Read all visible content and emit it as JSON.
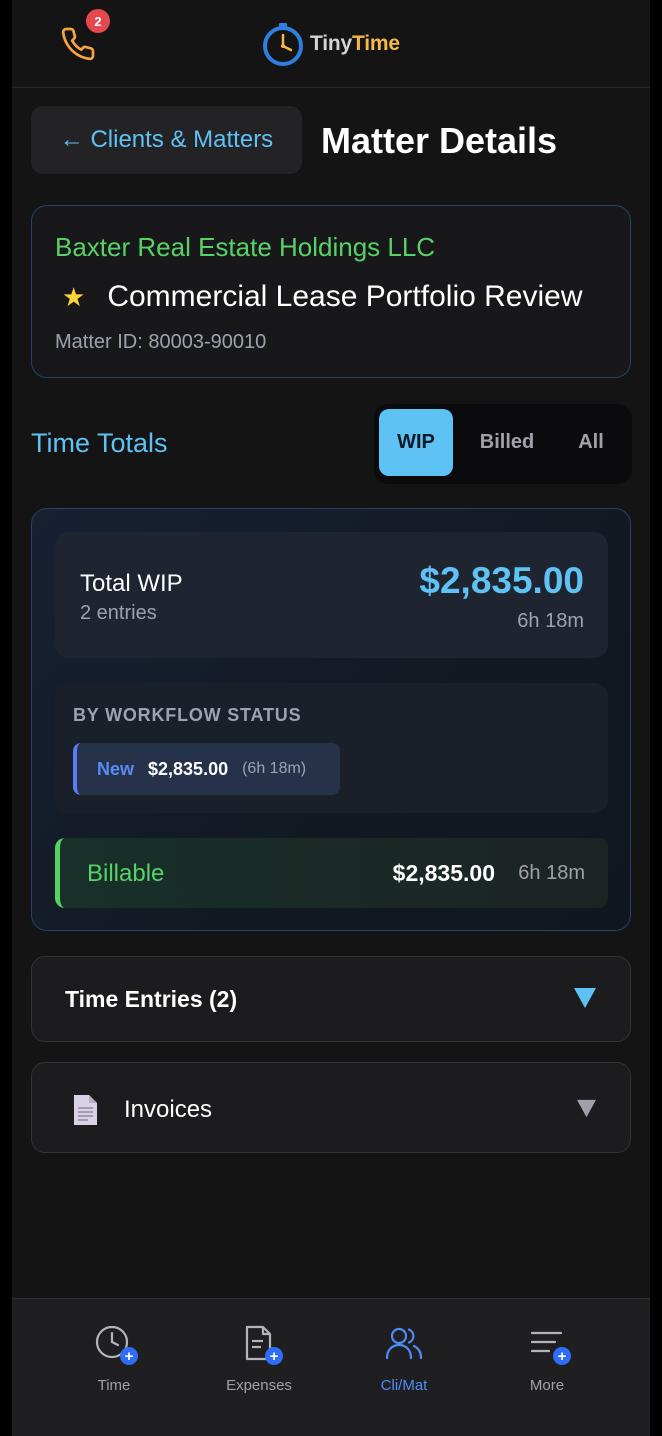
{
  "header": {
    "notification_count": "2",
    "logo_tiny": "Tiny",
    "logo_time": "Time"
  },
  "nav_bar": {
    "back_label": "← Clients & Matters",
    "page_title": "Matter Details"
  },
  "matter": {
    "client_name": "Baxter Real Estate Holdings LLC",
    "star": "★",
    "title": "Commercial Lease Portfolio Review",
    "matter_id": "Matter ID: 80003-90010"
  },
  "time_totals": {
    "label": "Time Totals",
    "filters": [
      "WIP",
      "Billed",
      "All"
    ],
    "active_filter": "WIP",
    "total_label": "Total WIP",
    "entry_count": "2 entries",
    "total_amount": "$2,835.00",
    "total_hours": "6h 18m",
    "workflow_heading": "BY WORKFLOW STATUS",
    "workflow_status": {
      "name": "New",
      "amount": "$2,835.00",
      "hours": "(6h 18m)"
    },
    "billable": {
      "label": "Billable",
      "amount": "$2,835.00",
      "hours": "6h 18m"
    }
  },
  "sections": {
    "time_entries_title": "Time Entries (2)",
    "invoices_title": "Invoices"
  },
  "bottom_nav": {
    "items": [
      {
        "label": "Time",
        "icon": "clock-add-icon"
      },
      {
        "label": "Expenses",
        "icon": "receipt-add-icon"
      },
      {
        "label": "Cli/Mat",
        "icon": "users-icon"
      },
      {
        "label": "More",
        "icon": "menu-add-icon"
      }
    ],
    "active": "Cli/Mat"
  },
  "colors": {
    "accent": "#5ec2f4",
    "client_green": "#56d364",
    "badge_red": "#e5484d",
    "nav_active": "#4f8cf7"
  }
}
